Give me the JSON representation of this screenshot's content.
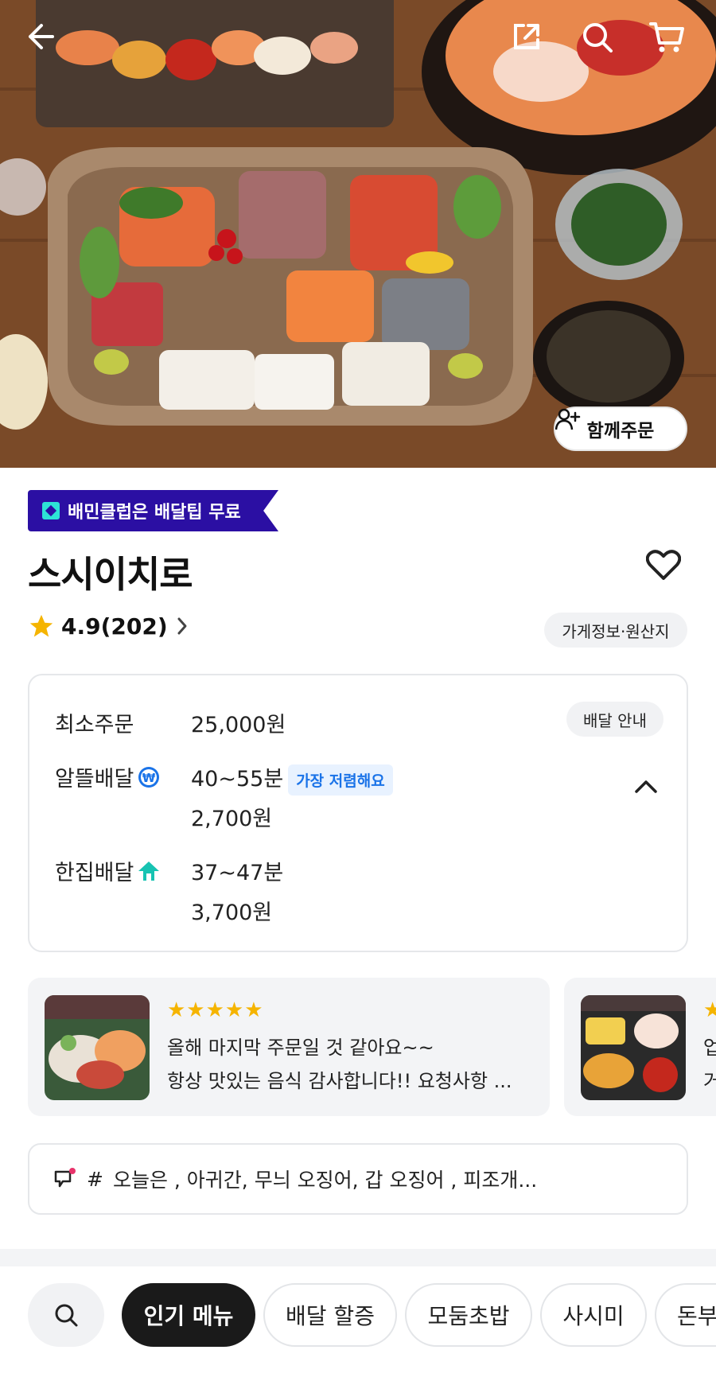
{
  "header": {
    "together_order_label": "함께주문"
  },
  "club_banner": "배민클럽은 배달팁 무료",
  "store": {
    "name": "스시이치로",
    "rating": "4.9(202)",
    "info_chip": "가게정보·원산지"
  },
  "delivery": {
    "min_order_label": "최소주문",
    "min_order_value": "25,000원",
    "guide_chip": "배달 안내",
    "options": [
      {
        "label": "알뜰배달",
        "time": "40~55분",
        "badge": "가장 저렴해요",
        "fee": "2,700원"
      },
      {
        "label": "한집배달",
        "time": "37~47분",
        "fee": "3,700원"
      }
    ]
  },
  "reviews": [
    {
      "stars": "★★★★★",
      "line1": "올해 마지막 주문일 것 같아요~~",
      "line2": "항상 맛있는 음식 감사합니다!! 요청사항 ..."
    },
    {
      "stars": "★",
      "line1": "업",
      "line2": "거"
    }
  ],
  "notice": {
    "hash": "#",
    "text": "오늘은 , 아귀간,  무늬 오징어, 갑 오징어 , 피조개..."
  },
  "tabs": [
    "인기 메뉴",
    "배달 할증",
    "모둠초밥",
    "사시미",
    "돈부"
  ],
  "colors": {
    "club_banner_bg": "#2b0fa3",
    "star": "#f5b400",
    "cheap_badge_text": "#1a73e8",
    "active_tab_bg": "#1a1a1a"
  }
}
